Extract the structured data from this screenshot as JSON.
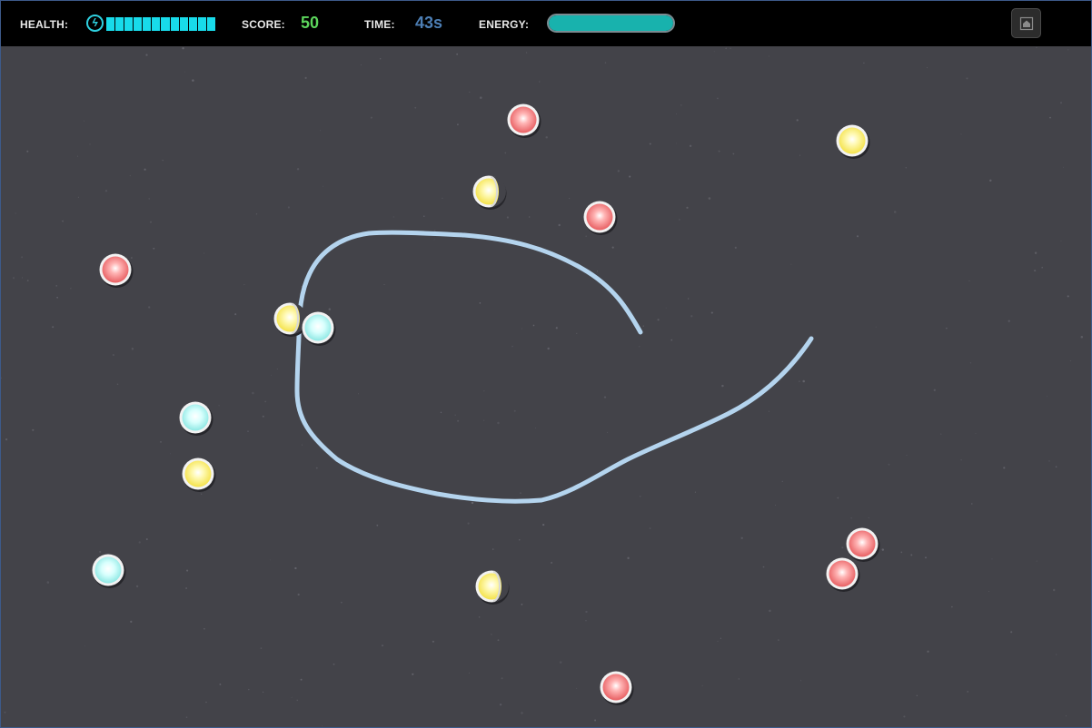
{
  "hud": {
    "health_label": "HEALTH:",
    "health_segments": 12,
    "score_label": "SCORE:",
    "score_value": "50",
    "time_label": "TIME:",
    "time_value": "43s",
    "energy_label": "ENERGY:",
    "energy_level": 1.0,
    "health_icon": "lightning-icon",
    "home_icon": "home-icon"
  },
  "colors": {
    "health": "#18dbea",
    "score": "#5cd65c",
    "time": "#4d7fb5",
    "energy": "#18b2ad",
    "field": "#434349",
    "trail": "#b4d4ee",
    "orb_red": "#f07878",
    "orb_yellow": "#ffef7a",
    "orb_cyan": "#bff8f6"
  }
}
